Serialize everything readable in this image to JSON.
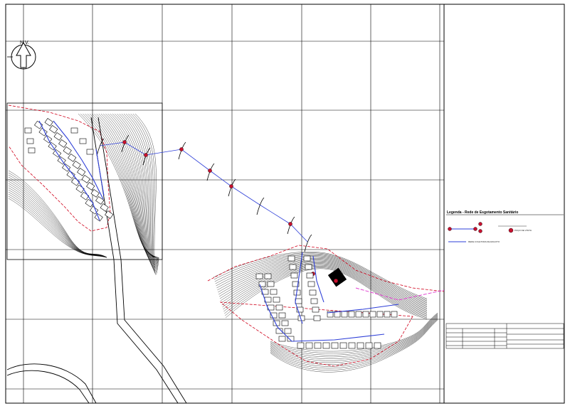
{
  "north_label": "N.V.",
  "legend": {
    "title": "Legenda - Rede de Esgotamento Sanitário",
    "entries": [
      "POÇO DE VISITA",
      "REDE COLETORA DE ESGOTO"
    ]
  },
  "colors": {
    "sewer_line": "#2e3fd8",
    "manhole": "#c8102e",
    "boundary": "#d0021b",
    "road_pink": "#e040d0",
    "contour": "#000000",
    "grid": "#000000"
  }
}
